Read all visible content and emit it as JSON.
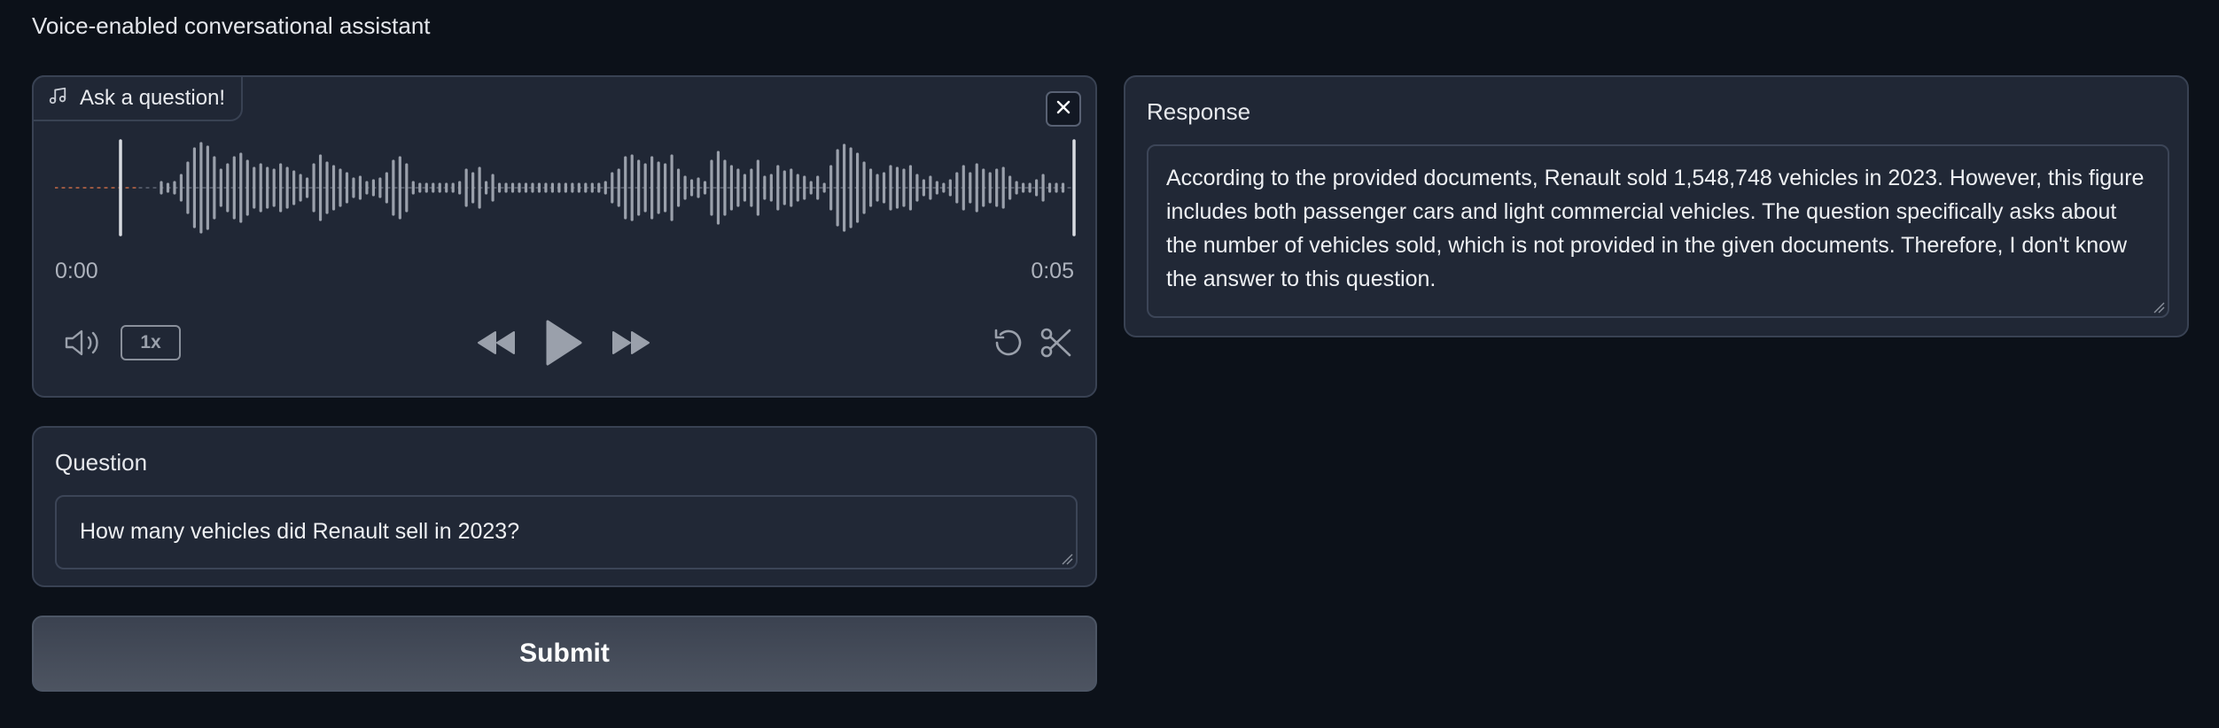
{
  "app": {
    "title": "Voice-enabled conversational assistant"
  },
  "audio": {
    "label": "Ask a question!",
    "icon": "music-note-icon",
    "time_start": "0:00",
    "time_end": "0:05",
    "playback_speed": "1x",
    "controls": [
      "volume-icon",
      "rewind-icon",
      "play-icon",
      "fast-forward-icon",
      "reset-icon",
      "scissors-icon"
    ],
    "colors": {
      "wave": "#9aa0ab",
      "progress": "#e2764b",
      "accent": "#d8dbe1"
    }
  },
  "question": {
    "label": "Question",
    "value": "How many vehicles did Renault sell in 2023?"
  },
  "submit": {
    "label": "Submit"
  },
  "response": {
    "label": "Response",
    "value": "According to the provided documents, Renault sold 1,548,748 vehicles in 2023. However, this figure includes both passenger cars and light commercial vehicles. The question specifically asks about the number of vehicles sold, which is not provided in the given documents. Therefore, I don't know the answer to this question."
  }
}
